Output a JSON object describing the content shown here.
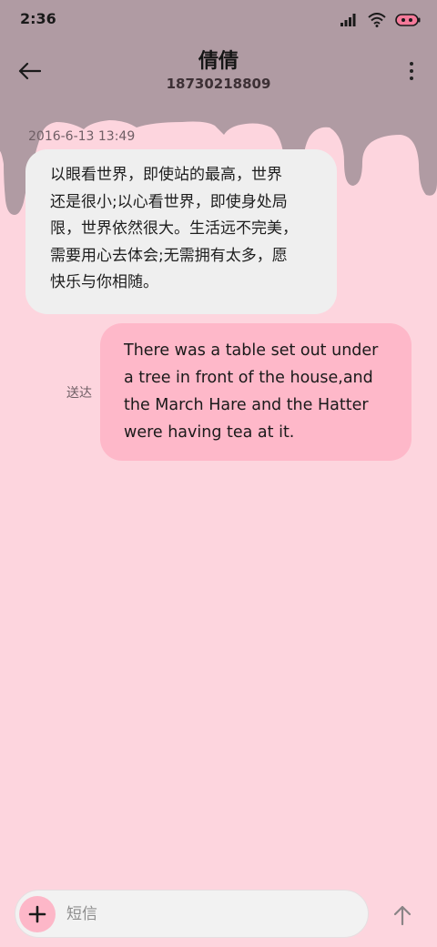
{
  "status_bar": {
    "time": "2:36",
    "icons": [
      "signal-icon",
      "wifi-icon",
      "battery-icon"
    ]
  },
  "header": {
    "contact_name": "倩倩",
    "phone_number": "18730218809",
    "back_icon": "back-arrow-icon",
    "menu_icon": "more-vertical-icon"
  },
  "conversation": {
    "timestamp": "2016-6-13 13:49",
    "incoming": {
      "lines": [
        "以眼看世界，即使站的最高，世界",
        "还是很小;以心看世界，即使身处局",
        "限，世界依然很大。生活远不完美，",
        "需要用心去体会;无需拥有太多，愿",
        "快乐与你相随。"
      ]
    },
    "outgoing": {
      "lines": [
        "There was a table set out under",
        "a tree in front of the house,and",
        "the March Hare and the Hatter",
        "were having tea at it."
      ],
      "status": "送达"
    }
  },
  "composer": {
    "placeholder": "短信",
    "value": "",
    "add_icon": "plus-icon",
    "send_icon": "send-arrow-icon"
  },
  "theme": {
    "background": "#fdd5de",
    "drip_color": "#b09ba3",
    "incoming_bubble": "#efefef",
    "outgoing_bubble": "#feb8c9",
    "accent": "#fdb7c8"
  }
}
